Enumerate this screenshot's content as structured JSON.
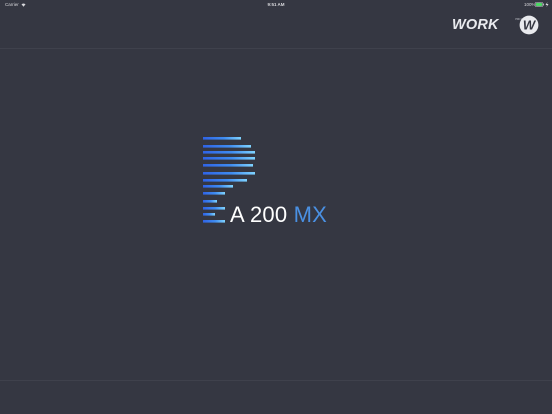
{
  "status_bar": {
    "carrier": "Carrier",
    "time": "9:51 AM",
    "battery_percent": "100%",
    "icons": [
      "wifi-icon",
      "battery-icon",
      "charging-icon"
    ]
  },
  "header": {
    "brand": {
      "text": "WORK",
      "sub_text": "PRO AUDIO",
      "mark_letter": "W"
    }
  },
  "splash": {
    "product_model": "A 200",
    "product_suffix": "MX"
  },
  "colors": {
    "background": "#353742",
    "divider": "#3f414c",
    "accent_blue": "#4a90e2",
    "bar_cyan": "#7fd3ff",
    "bar_blue": "#2f63e6"
  }
}
